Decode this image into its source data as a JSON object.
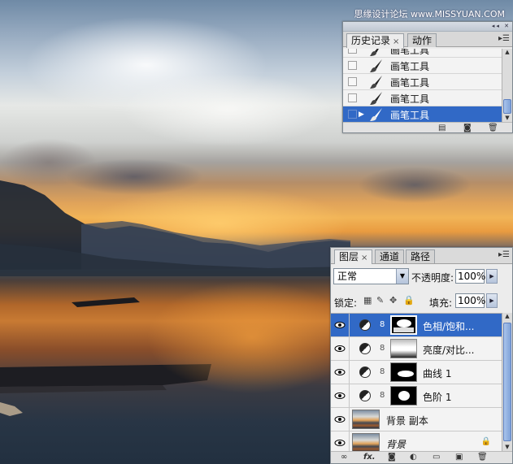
{
  "watermark": "思缘设计论坛 www.MISSYUAN.COM",
  "history_panel": {
    "tabs": [
      {
        "label": "历史记录",
        "close": "×",
        "active": true
      },
      {
        "label": "动作",
        "active": false
      }
    ],
    "items": [
      {
        "label": "画笔工具",
        "selected": false
      },
      {
        "label": "画笔工具",
        "selected": false
      },
      {
        "label": "画笔工具",
        "selected": false
      },
      {
        "label": "画笔工具",
        "selected": false
      },
      {
        "label": "画笔工具",
        "selected": true
      }
    ],
    "bottom_icons": [
      "new-document-icon",
      "camera-icon",
      "trash-icon"
    ]
  },
  "layers_panel": {
    "tabs": [
      {
        "label": "图层",
        "close": "×",
        "active": true
      },
      {
        "label": "通道",
        "active": false
      },
      {
        "label": "路径",
        "active": false
      }
    ],
    "blend_mode": "正常",
    "opacity_label": "不透明度:",
    "opacity_value": "100%",
    "lock_label": "锁定:",
    "fill_label": "填充:",
    "fill_value": "100%",
    "layers": [
      {
        "name": "色相/饱和...",
        "selected": true
      },
      {
        "name": "亮度/对比..."
      },
      {
        "name": "曲线 1"
      },
      {
        "name": "色阶 1"
      },
      {
        "name": "背景 副本"
      },
      {
        "name": "背景",
        "locked": true
      }
    ],
    "bottom_icons": [
      "link-icon",
      "fx-icon",
      "mask-icon",
      "adjustment-icon",
      "folder-icon",
      "new-layer-icon",
      "trash-icon"
    ],
    "fx_label": "fx."
  },
  "colors": {
    "selection": "#3169c6",
    "panel_bg": "#ececec"
  }
}
